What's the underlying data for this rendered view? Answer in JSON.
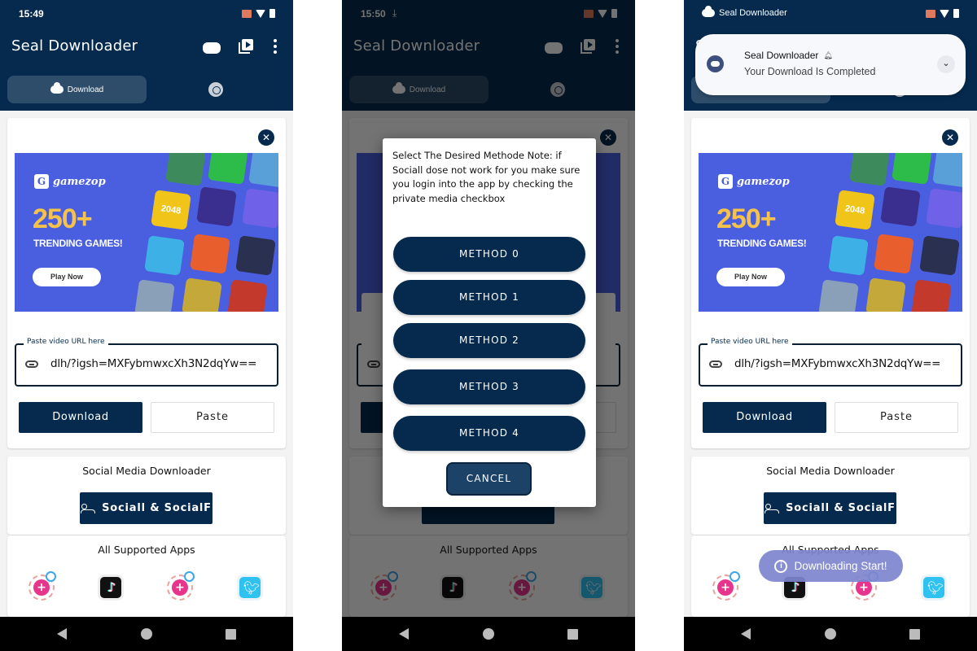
{
  "colors": {
    "primary": "#052a4e",
    "ad_background": "#4a5fe0",
    "ad_accent": "#f6c24a",
    "toast": "#7e84ce"
  },
  "screens": [
    {
      "status_bar": {
        "time": "15:49"
      },
      "app_bar": {
        "title": "Seal Downloader",
        "actions": [
          "gamepad-icon",
          "video-library-icon",
          "more-vert-icon"
        ]
      },
      "tabs": [
        {
          "label": "Download",
          "icon": "cloud-download-icon",
          "selected": true
        },
        {
          "label": "",
          "icon": "target-icon",
          "selected": false
        }
      ],
      "ad": {
        "brand": "gamezop",
        "headline": "250+",
        "subheadline": "TRENDING GAMES!",
        "cta": "Play Now",
        "tiles": [
          "2048"
        ]
      },
      "url_field": {
        "label": "Paste video URL here",
        "value": "dlh/?igsh=MXFybmwxcXh3N2dqYw=="
      },
      "buttons": {
        "download": "Download",
        "paste": "Paste"
      },
      "social_section": {
        "heading": "Social Media Downloader",
        "button": "Sociall & SocialF"
      },
      "apps_section": {
        "heading": "All Supported Apps",
        "apps": [
          "Instagram",
          "TikTok",
          "Instagram",
          "Twitter"
        ]
      }
    },
    {
      "status_bar": {
        "time": "15:50"
      },
      "app_bar": {
        "title": "Seal Downloader"
      },
      "tabs": [
        {
          "label": "Download"
        }
      ],
      "dialog": {
        "message": "Select The Desired Methode Note: if Sociall dose not work for you make sure you login into the app by checking the private media checkbox",
        "methods": [
          "METHOD 0",
          "METHOD 1",
          "METHOD 2",
          "METHOD 3",
          "METHOD 4"
        ],
        "cancel": "CANCEL"
      },
      "apps_section": {
        "heading": "All Supported Apps"
      }
    },
    {
      "status_bar": {
        "app_name": "Seal Downloader"
      },
      "notification": {
        "title": "Seal Downloader",
        "text": "Your Download Is Completed"
      },
      "app_bar": {
        "title": "Seal Downloader"
      },
      "ad": {
        "brand": "gamezop",
        "headline": "250+",
        "subheadline": "TRENDING GAMES!",
        "cta": "Play Now",
        "tiles": [
          "2048"
        ]
      },
      "url_field": {
        "label": "Paste video URL here",
        "value": "dlh/?igsh=MXFybmwxcXh3N2dqYw=="
      },
      "buttons": {
        "download": "Download",
        "paste": "Paste"
      },
      "social_section": {
        "heading": "Social Media Downloader",
        "button": "Sociall & SocialF"
      },
      "apps_section": {
        "heading": "All Supported Apps"
      },
      "toast": {
        "text": "Downloading Start!"
      }
    }
  ]
}
